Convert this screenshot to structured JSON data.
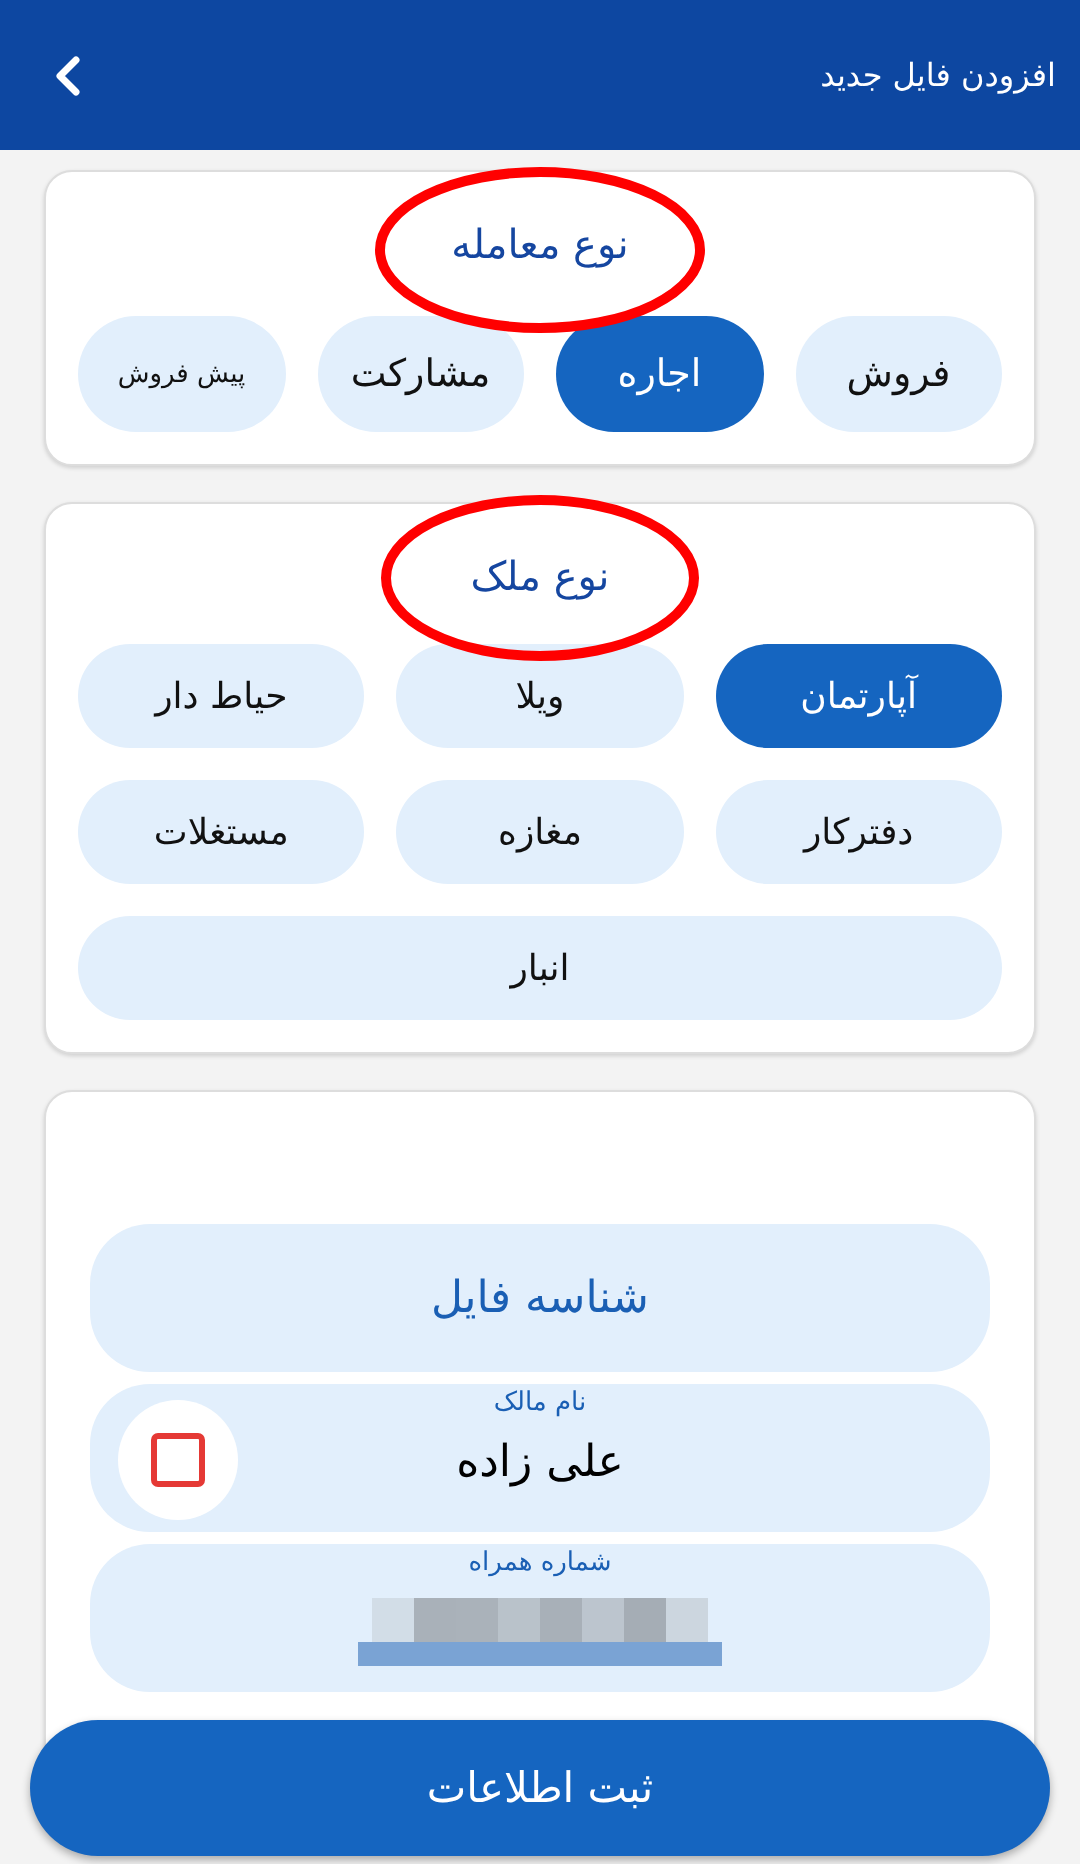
{
  "header": {
    "title": "افزودن فایل جدید"
  },
  "deal_type": {
    "title": "نوع معامله",
    "highlighted": true,
    "options": [
      {
        "label": "فروش",
        "selected": false,
        "kind": "regular"
      },
      {
        "label": "اجاره",
        "selected": true,
        "kind": "regular"
      },
      {
        "label": "مشارکت",
        "selected": false,
        "kind": "regular"
      },
      {
        "label": "پیش فروش",
        "selected": false,
        "kind": "compact"
      }
    ]
  },
  "property_type": {
    "title": "نوع ملک",
    "highlighted": true,
    "options": [
      {
        "label": "آپارتمان",
        "selected": true
      },
      {
        "label": "ویلا",
        "selected": false
      },
      {
        "label": "حیاط دار",
        "selected": false
      },
      {
        "label": "دفترکار",
        "selected": false
      },
      {
        "label": "مغازه",
        "selected": false
      },
      {
        "label": "مستغلات",
        "selected": false
      },
      {
        "label": "انبار",
        "selected": false
      }
    ]
  },
  "file_id": {
    "label": "شناسه فایل"
  },
  "fields": [
    {
      "kind": "name",
      "label": "نام مالک",
      "value": "علی زاده",
      "checked": false
    },
    {
      "kind": "phone",
      "label": "شماره همراه",
      "redacted": true
    }
  ],
  "submit_button": "ثبت اطلاعات"
}
